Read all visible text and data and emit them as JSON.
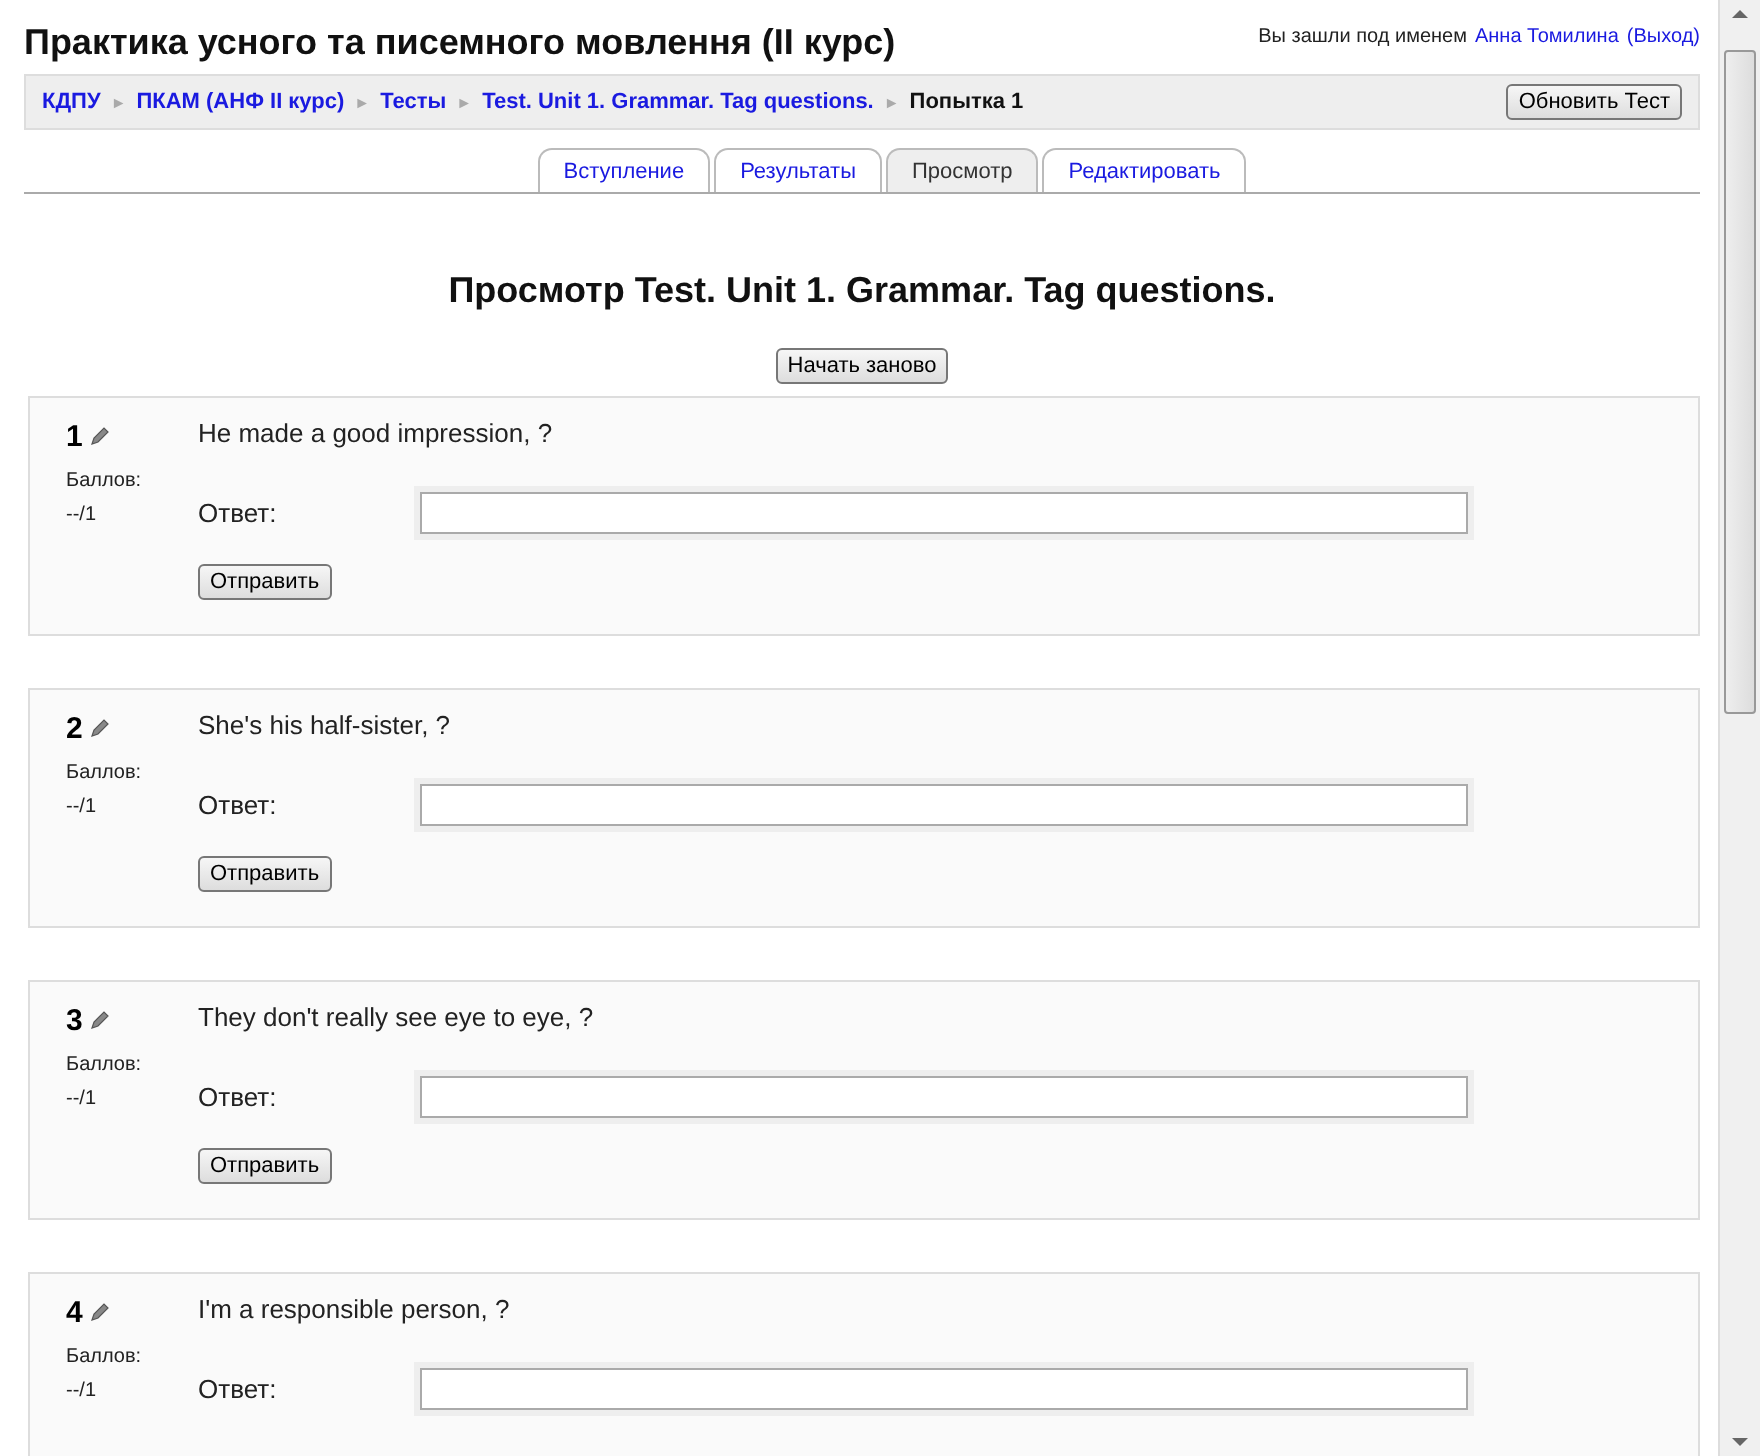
{
  "header": {
    "title": "Практика усного та писемного мовлення (II курс)",
    "login_text": "Вы зашли под именем",
    "user_link": "Анна Томилина",
    "logout_link": "(Выход)"
  },
  "breadcrumb": {
    "items": [
      {
        "label": "КДПУ",
        "link": true
      },
      {
        "label": "ПКАМ (АНФ II курс)",
        "link": true
      },
      {
        "label": "Тесты",
        "link": true
      },
      {
        "label": "Test. Unit 1. Grammar. Tag questions.",
        "link": true
      },
      {
        "label": "Попытка 1",
        "link": false
      }
    ],
    "separator": "►",
    "button": "Обновить Тест"
  },
  "tabs": [
    {
      "label": "Вступление",
      "selected": false
    },
    {
      "label": "Результаты",
      "selected": false
    },
    {
      "label": "Просмотр",
      "selected": true
    },
    {
      "label": "Редактировать",
      "selected": false
    }
  ],
  "heading": "Просмотр Test. Unit 1. Grammar. Tag questions.",
  "restart_button": "Начать заново",
  "questions": [
    {
      "number": "1",
      "score_label": "Баллов:",
      "score": "--/1",
      "text": "He made a good impression, ?",
      "answer_label": "Ответ:",
      "submit": "Отправить"
    },
    {
      "number": "2",
      "score_label": "Баллов:",
      "score": "--/1",
      "text": "She's his half-sister, ?",
      "answer_label": "Ответ:",
      "submit": "Отправить"
    },
    {
      "number": "3",
      "score_label": "Баллов:",
      "score": "--/1",
      "text": "They don't really see eye to eye, ?",
      "answer_label": "Ответ:",
      "submit": "Отправить"
    },
    {
      "number": "4",
      "score_label": "Баллов:",
      "score": "--/1",
      "text": "I'm a responsible person, ?",
      "answer_label": "Ответ:"
    }
  ]
}
